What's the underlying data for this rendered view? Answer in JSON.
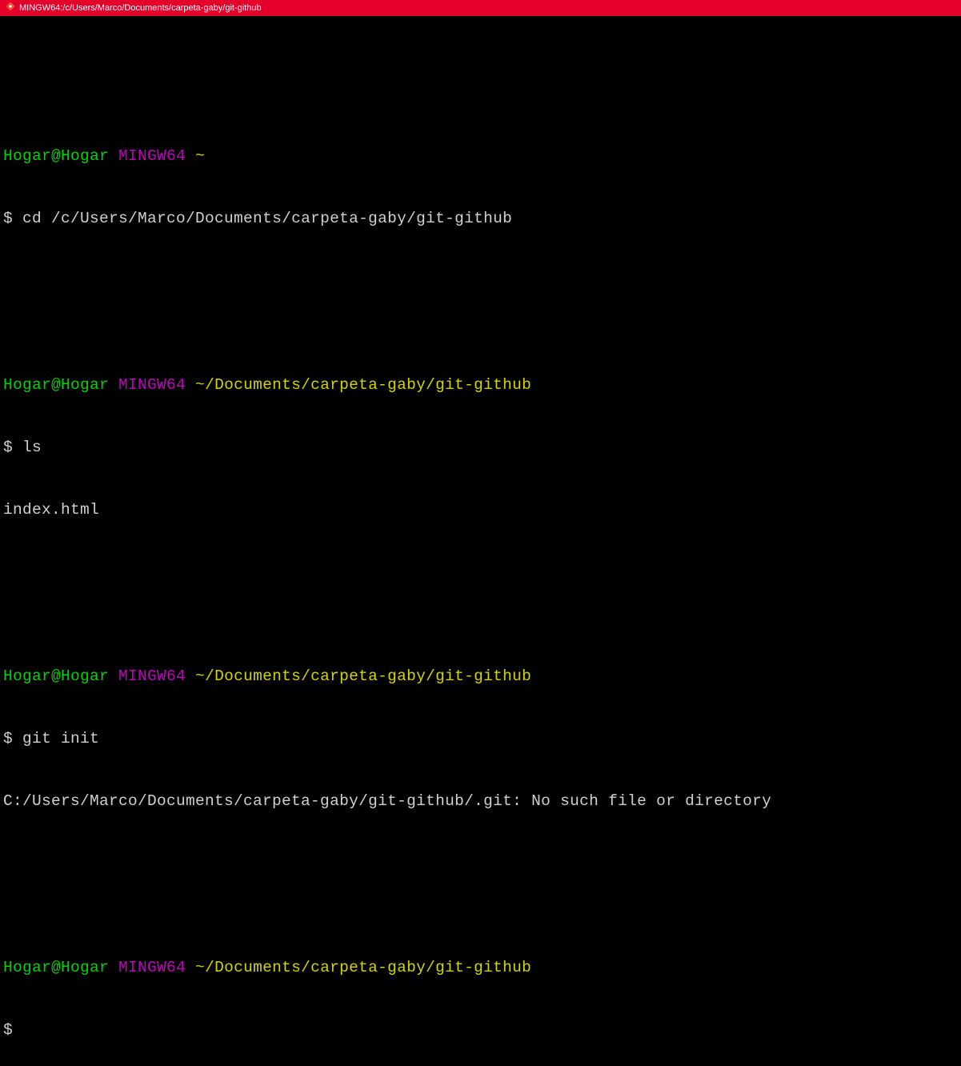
{
  "titlebar": {
    "title": "MINGW64:/c/Users/Marco/Documents/carpeta-gaby/git-github"
  },
  "blocks": [
    {
      "user_host": "Hogar@Hogar",
      "mingw": "MINGW64",
      "path": "~",
      "prompt": "$ ",
      "command": "cd /c/Users/Marco/Documents/carpeta-gaby/git-github",
      "output": []
    },
    {
      "user_host": "Hogar@Hogar",
      "mingw": "MINGW64",
      "path": "~/Documents/carpeta-gaby/git-github",
      "prompt": "$ ",
      "command": "ls",
      "output": [
        "index.html"
      ]
    },
    {
      "user_host": "Hogar@Hogar",
      "mingw": "MINGW64",
      "path": "~/Documents/carpeta-gaby/git-github",
      "prompt": "$ ",
      "command": "git init",
      "output": [
        "C:/Users/Marco/Documents/carpeta-gaby/git-github/.git: No such file or directory"
      ]
    },
    {
      "user_host": "Hogar@Hogar",
      "mingw": "MINGW64",
      "path": "~/Documents/carpeta-gaby/git-github",
      "prompt": "$",
      "command": "",
      "output": []
    }
  ]
}
